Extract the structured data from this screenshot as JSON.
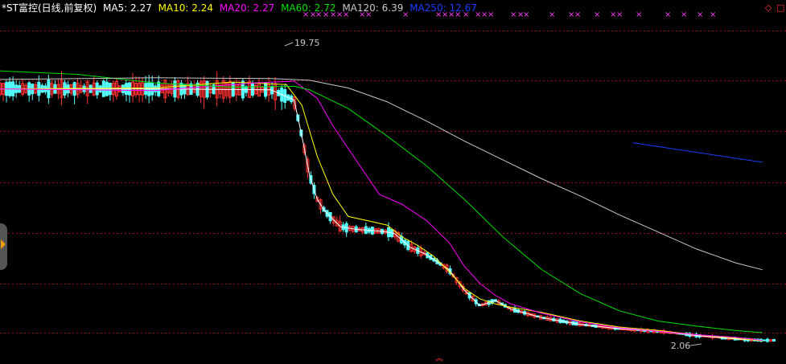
{
  "legend": {
    "title": "*ST富控(日线,前复权)",
    "items": [
      {
        "label": "MA5: 2.27",
        "color": "#ffffff"
      },
      {
        "label": "MA10: 2.24",
        "color": "#ffff00"
      },
      {
        "label": "MA20: 2.27",
        "color": "#ff00ff"
      },
      {
        "label": "MA60: 2.72",
        "color": "#00e000"
      },
      {
        "label": "MA120: 6.39",
        "color": "#c8c8c8"
      },
      {
        "label": "MA250: 12.67",
        "color": "#1c3cff"
      }
    ]
  },
  "colors": {
    "up": "#ff3232",
    "down": "#54ffff",
    "grid": "#a01010",
    "background": "#000000",
    "marker": "#ff40ff"
  },
  "chart_data": {
    "type": "candlestick",
    "price_range": [
      1.5,
      21.2
    ],
    "grid": true,
    "annotations": {
      "high": {
        "label": "19.75",
        "value": 19.75
      },
      "low": {
        "label": "2.06",
        "value": 2.06
      }
    },
    "ma_lines": {
      "MA5": [
        [
          0.0,
          16.95
        ],
        [
          0.2,
          16.95
        ],
        [
          0.35,
          16.9
        ],
        [
          0.38,
          16.3
        ],
        [
          0.39,
          14.2
        ],
        [
          0.4,
          11.9
        ],
        [
          0.41,
          10.5
        ],
        [
          0.42,
          9.8
        ],
        [
          0.44,
          8.9
        ],
        [
          0.46,
          8.75
        ],
        [
          0.49,
          8.65
        ],
        [
          0.5,
          8.6
        ],
        [
          0.51,
          8.5
        ],
        [
          0.53,
          7.7
        ],
        [
          0.55,
          7.3
        ],
        [
          0.58,
          6.4
        ],
        [
          0.6,
          5.2
        ],
        [
          0.62,
          4.3
        ],
        [
          0.64,
          4.6
        ],
        [
          0.66,
          4.1
        ],
        [
          0.7,
          3.6
        ],
        [
          0.75,
          3.2
        ],
        [
          0.8,
          2.95
        ],
        [
          0.85,
          2.8
        ],
        [
          0.9,
          2.55
        ],
        [
          0.95,
          2.35
        ],
        [
          0.985,
          2.27
        ]
      ],
      "MA10": [
        [
          0.0,
          16.95
        ],
        [
          0.2,
          17.0
        ],
        [
          0.3,
          17.35
        ],
        [
          0.37,
          17.2
        ],
        [
          0.39,
          16.0
        ],
        [
          0.41,
          13.0
        ],
        [
          0.43,
          10.8
        ],
        [
          0.45,
          9.5
        ],
        [
          0.48,
          9.2
        ],
        [
          0.5,
          9.0
        ],
        [
          0.52,
          8.3
        ],
        [
          0.54,
          7.8
        ],
        [
          0.56,
          7.2
        ],
        [
          0.58,
          6.3
        ],
        [
          0.6,
          5.3
        ],
        [
          0.62,
          4.7
        ],
        [
          0.64,
          4.4
        ],
        [
          0.66,
          4.2
        ],
        [
          0.7,
          3.9
        ],
        [
          0.75,
          3.4
        ],
        [
          0.8,
          3.05
        ],
        [
          0.85,
          2.85
        ],
        [
          0.9,
          2.6
        ],
        [
          0.95,
          2.4
        ],
        [
          0.985,
          2.24
        ]
      ],
      "MA20": [
        [
          0.0,
          16.95
        ],
        [
          0.2,
          16.85
        ],
        [
          0.33,
          17.3
        ],
        [
          0.38,
          17.4
        ],
        [
          0.41,
          16.4
        ],
        [
          0.43,
          14.8
        ],
        [
          0.46,
          12.8
        ],
        [
          0.49,
          10.8
        ],
        [
          0.52,
          10.2
        ],
        [
          0.55,
          9.3
        ],
        [
          0.58,
          8.0
        ],
        [
          0.6,
          6.6
        ],
        [
          0.62,
          5.6
        ],
        [
          0.64,
          4.9
        ],
        [
          0.66,
          4.4
        ],
        [
          0.7,
          3.85
        ],
        [
          0.75,
          3.35
        ],
        [
          0.8,
          3.0
        ],
        [
          0.85,
          2.8
        ],
        [
          0.9,
          2.6
        ],
        [
          0.95,
          2.45
        ],
        [
          0.985,
          2.27
        ]
      ],
      "MA60": [
        [
          0.0,
          18.0
        ],
        [
          0.1,
          17.8
        ],
        [
          0.2,
          17.3
        ],
        [
          0.3,
          17.05
        ],
        [
          0.38,
          17.1
        ],
        [
          0.4,
          16.9
        ],
        [
          0.45,
          15.8
        ],
        [
          0.5,
          14.2
        ],
        [
          0.55,
          12.5
        ],
        [
          0.6,
          10.5
        ],
        [
          0.65,
          8.3
        ],
        [
          0.7,
          6.4
        ],
        [
          0.75,
          5.0
        ],
        [
          0.8,
          4.0
        ],
        [
          0.85,
          3.4
        ],
        [
          0.9,
          3.1
        ],
        [
          0.95,
          2.85
        ],
        [
          0.985,
          2.72
        ]
      ],
      "MA120": [
        [
          0.0,
          17.5
        ],
        [
          0.2,
          17.6
        ],
        [
          0.35,
          17.55
        ],
        [
          0.4,
          17.45
        ],
        [
          0.45,
          17.0
        ],
        [
          0.5,
          16.2
        ],
        [
          0.55,
          15.1
        ],
        [
          0.6,
          13.9
        ],
        [
          0.65,
          12.8
        ],
        [
          0.7,
          11.7
        ],
        [
          0.75,
          10.7
        ],
        [
          0.8,
          9.6
        ],
        [
          0.85,
          8.6
        ],
        [
          0.9,
          7.6
        ],
        [
          0.95,
          6.8
        ],
        [
          0.985,
          6.39
        ]
      ],
      "MA250": [
        [
          0.818,
          13.8
        ],
        [
          0.985,
          12.67
        ]
      ]
    }
  }
}
